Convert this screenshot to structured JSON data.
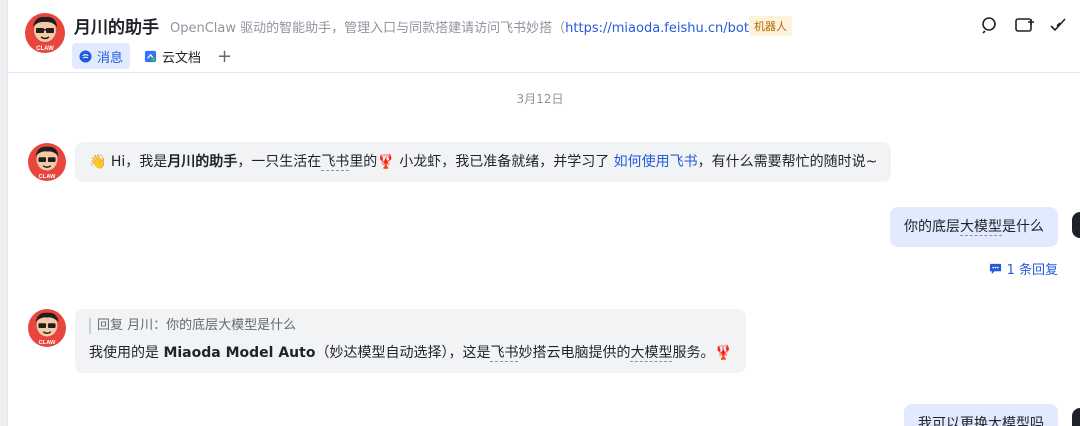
{
  "header": {
    "title": "月川的助手",
    "description_prefix": "OpenClaw 驱动的智能助手，管理入口与同款搭建请访问飞书妙搭（",
    "description_link": "https://miaoda.feishu.cn/bot",
    "description_suffix": "）",
    "badge": "机器人",
    "tabs": [
      {
        "label": "消息",
        "icon": "message-icon"
      },
      {
        "label": "云文档",
        "icon": "doc-icon"
      }
    ],
    "add_tab": "+",
    "actions": [
      "search-icon",
      "add-chat-icon",
      "more-icon"
    ]
  },
  "chat": {
    "date": "3月12日",
    "messages": [
      {
        "sender": "bot",
        "emoji_wave": "👋",
        "part1": " Hi，我是",
        "bold_name": "月川的助手",
        "part2": "，一只生活在",
        "dotted1": "飞书",
        "part3": "里的",
        "emoji_lobster": "🦞",
        "part4": " 小龙虾，我已准备就绪，并学习了 ",
        "link": "如何使用飞书",
        "part5": "，有什么需要帮忙的随时说~"
      },
      {
        "sender": "user",
        "pre": "你的底层",
        "dotted": "大模型",
        "post": "是什么",
        "reply_count": "1 条回复"
      },
      {
        "sender": "bot",
        "quote": "回复 月川：你的底层大模型是什么",
        "part1": "我使用的是 ",
        "bold_model": "Miaoda Model Auto",
        "part2": "（妙达模型自动选择），这是",
        "dotted1": "飞书",
        "part3": "妙搭云电脑提供的",
        "dotted2": "大模型",
        "part4": "服务。",
        "emoji_lobster": "🦞"
      },
      {
        "sender": "user",
        "text": "我可以更换大模型吗"
      }
    ]
  },
  "colors": {
    "accent": "#245bdb",
    "bubble_in": "#f2f3f5",
    "bubble_out": "#e1eaff",
    "badge_bg": "#fdf3dc"
  }
}
